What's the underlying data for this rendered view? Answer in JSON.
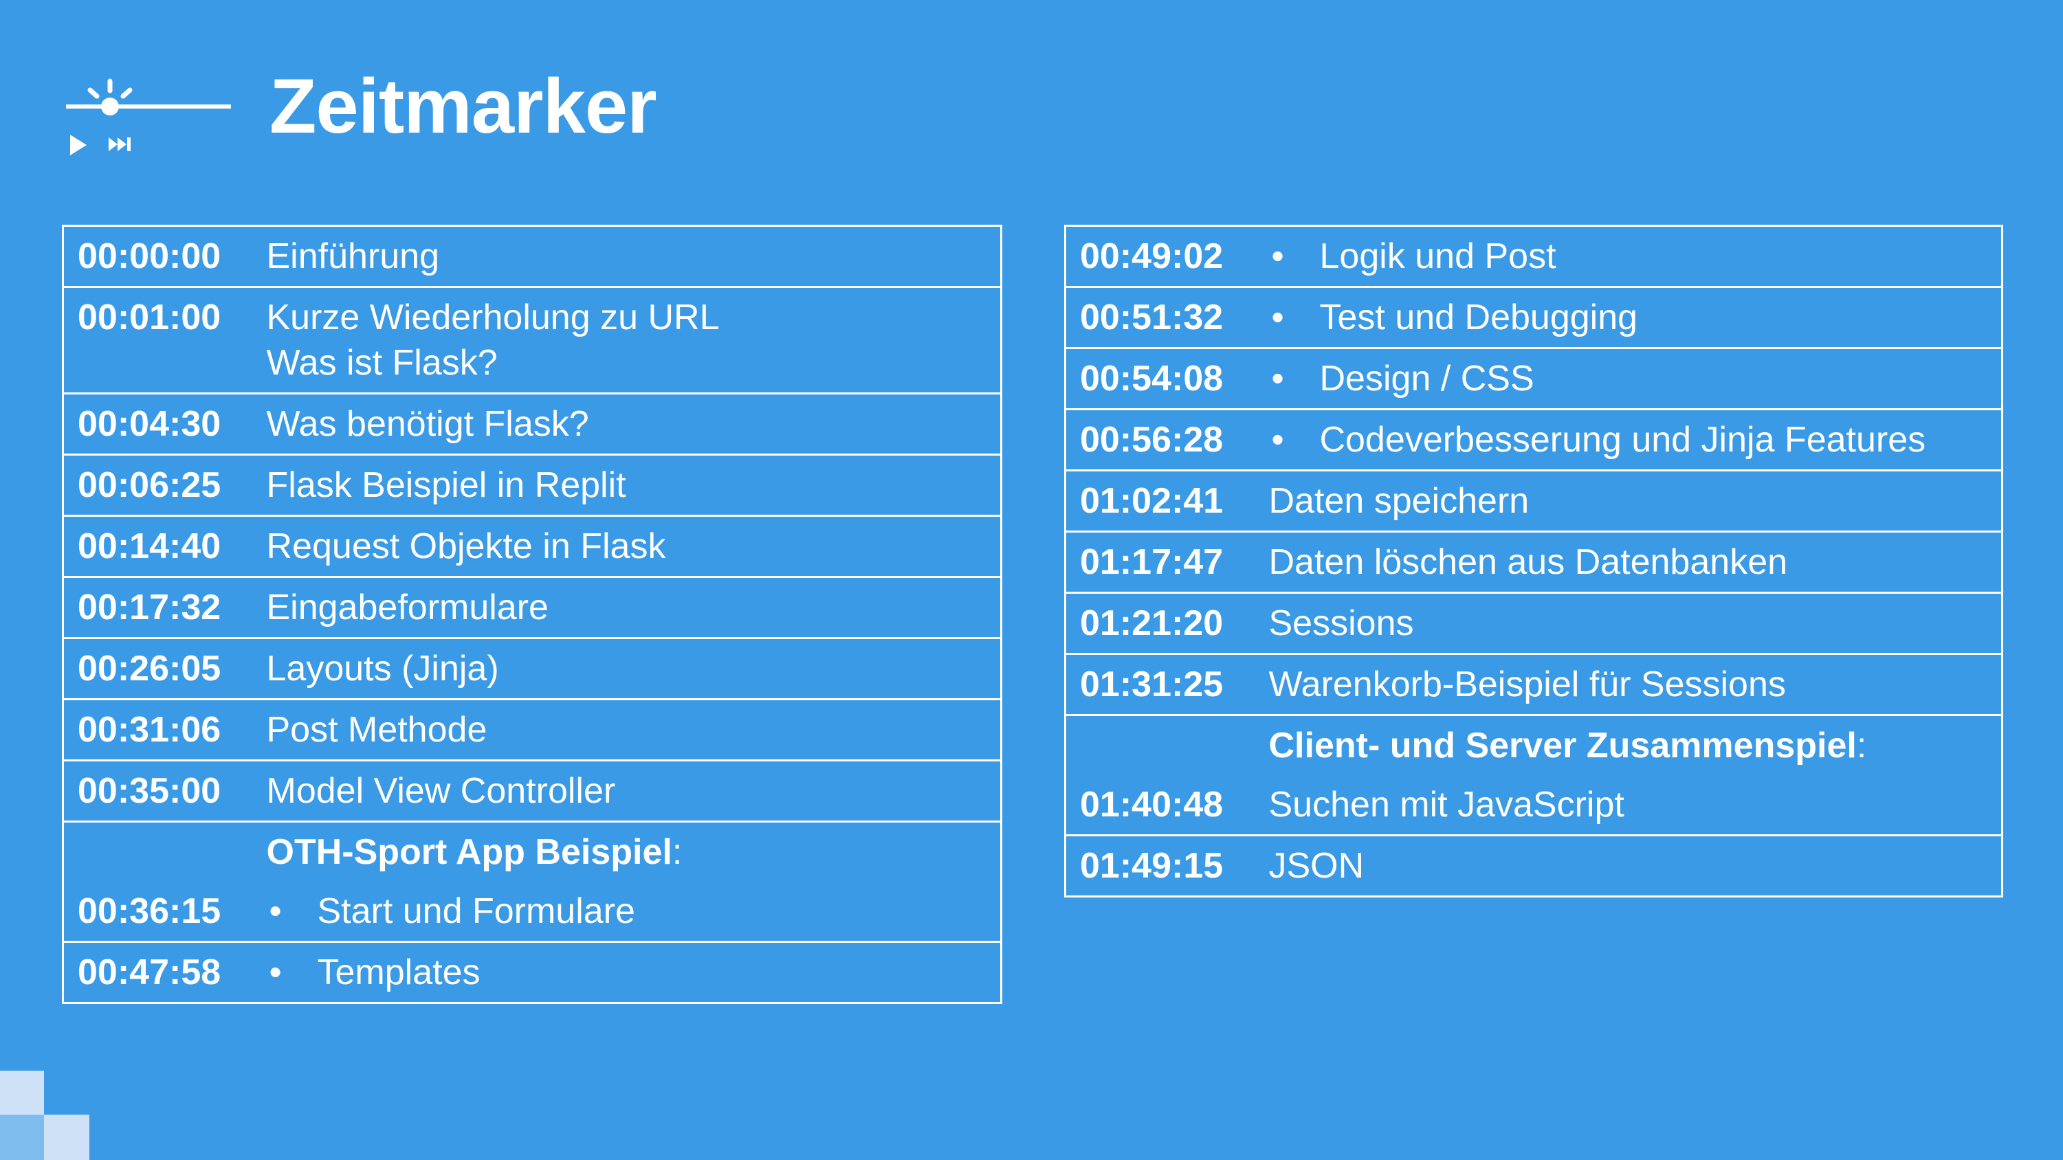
{
  "title": "Zeitmarker",
  "logo_icons": [
    "sun-icon",
    "timeline-icon",
    "play-icon",
    "skip-forward-icon"
  ],
  "colors": {
    "background": "#3a9ae6",
    "text": "#ffffff",
    "decor": "#cfe1f6"
  },
  "left_table": {
    "rows": [
      {
        "time": "00:00:00",
        "lines": [
          "Einführung"
        ]
      },
      {
        "time": "00:01:00",
        "lines": [
          "Kurze Wiederholung zu URL",
          "Was ist Flask?"
        ]
      },
      {
        "time": "00:04:30",
        "lines": [
          "Was benötigt Flask?"
        ]
      },
      {
        "time": "00:06:25",
        "lines": [
          "Flask Beispiel in Replit"
        ]
      },
      {
        "time": "00:14:40",
        "lines": [
          "Request Objekte in Flask"
        ]
      },
      {
        "time": "00:17:32",
        "lines": [
          "Eingabeformulare"
        ]
      },
      {
        "time": "00:26:05",
        "lines": [
          "Layouts (Jinja)"
        ]
      },
      {
        "time": "00:31:06",
        "lines": [
          "Post Methode"
        ]
      },
      {
        "time": "00:35:00",
        "lines": [
          "Model View Controller"
        ]
      },
      {
        "time": "",
        "heading": "OTH-Sport App Beispiel",
        "heading_suffix": ":"
      },
      {
        "time": "00:36:15",
        "bullet": "•",
        "text": "Start und Formulare",
        "no_border": true
      },
      {
        "time": "00:47:58",
        "bullet": "•",
        "text": "Templates"
      }
    ]
  },
  "right_table": {
    "rows": [
      {
        "time": "00:49:02",
        "bullet": "•",
        "text": "Logik und Post"
      },
      {
        "time": "00:51:32",
        "bullet": "•",
        "text": "Test und Debugging"
      },
      {
        "time": "00:54:08",
        "bullet": "•",
        "text": "Design / CSS"
      },
      {
        "time": "00:56:28",
        "bullet": "•",
        "text": "Codeverbesserung und Jinja Features",
        "tall": true
      },
      {
        "time": "01:02:41",
        "lines": [
          "Daten speichern"
        ]
      },
      {
        "time": "01:17:47",
        "lines": [
          "Daten löschen aus Datenbanken"
        ]
      },
      {
        "time": "01:21:20",
        "lines": [
          "Sessions"
        ]
      },
      {
        "time": "01:31:25",
        "lines": [
          "Warenkorb-Beispiel für Sessions"
        ]
      },
      {
        "time": "",
        "heading": "Client- und Server Zusammenspiel",
        "heading_suffix": ":"
      },
      {
        "time": "01:40:48",
        "lines": [
          "Suchen mit JavaScript"
        ],
        "no_border": true
      },
      {
        "time": "01:49:15",
        "lines": [
          "JSON"
        ]
      }
    ]
  }
}
